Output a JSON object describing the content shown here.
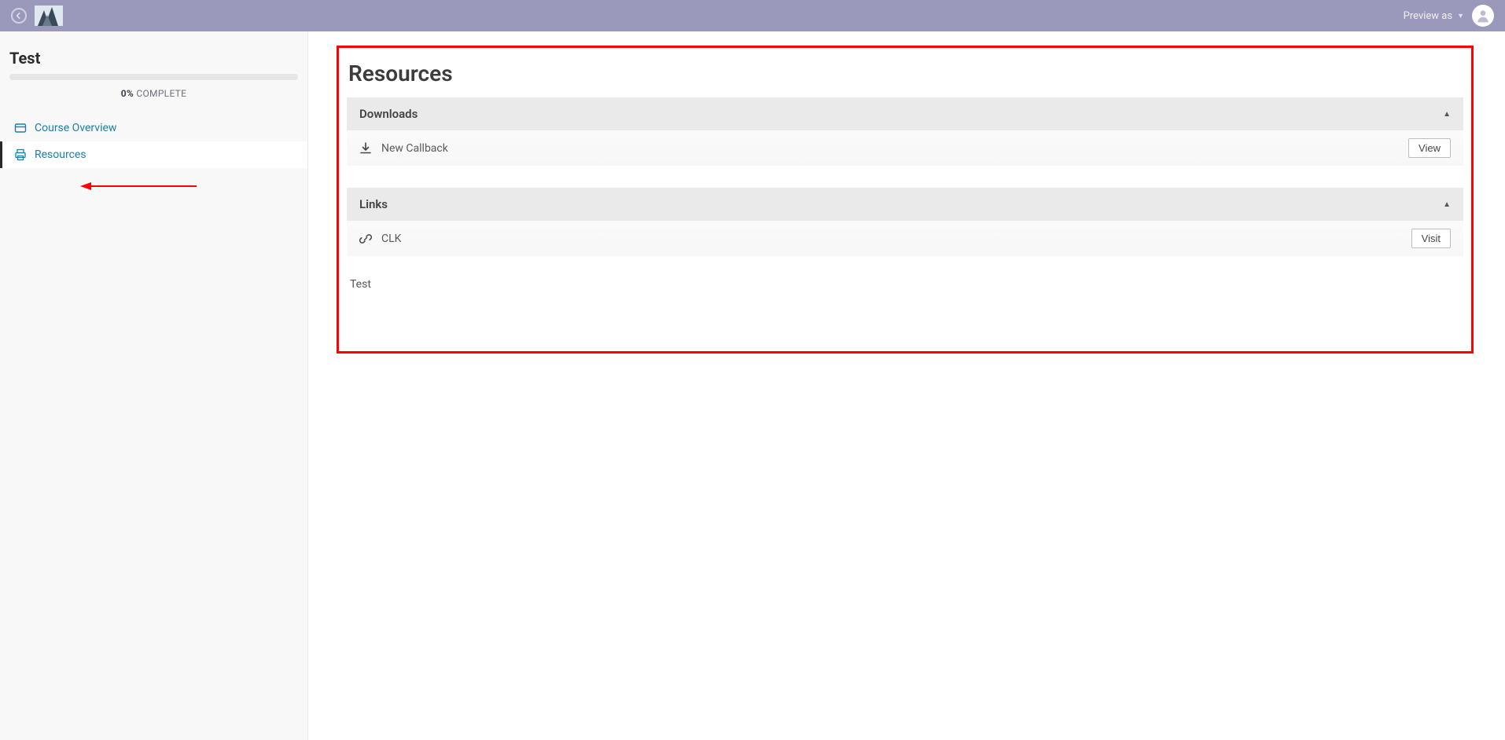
{
  "header": {
    "preview_as": "Preview as"
  },
  "sidebar": {
    "course_title": "Test",
    "progress_percent": "0%",
    "progress_suffix": " COMPLETE",
    "nav": [
      {
        "label": "Course Overview",
        "icon": "card-icon",
        "active": false
      },
      {
        "label": "Resources",
        "icon": "print-icon",
        "active": true
      }
    ]
  },
  "main": {
    "title": "Resources",
    "sections": [
      {
        "heading": "Downloads",
        "items": [
          {
            "icon": "download-icon",
            "label": "New Callback",
            "action": "View"
          }
        ]
      },
      {
        "heading": "Links",
        "items": [
          {
            "icon": "link-icon",
            "label": "CLK",
            "action": "Visit"
          }
        ]
      }
    ],
    "body_text": "Test"
  }
}
